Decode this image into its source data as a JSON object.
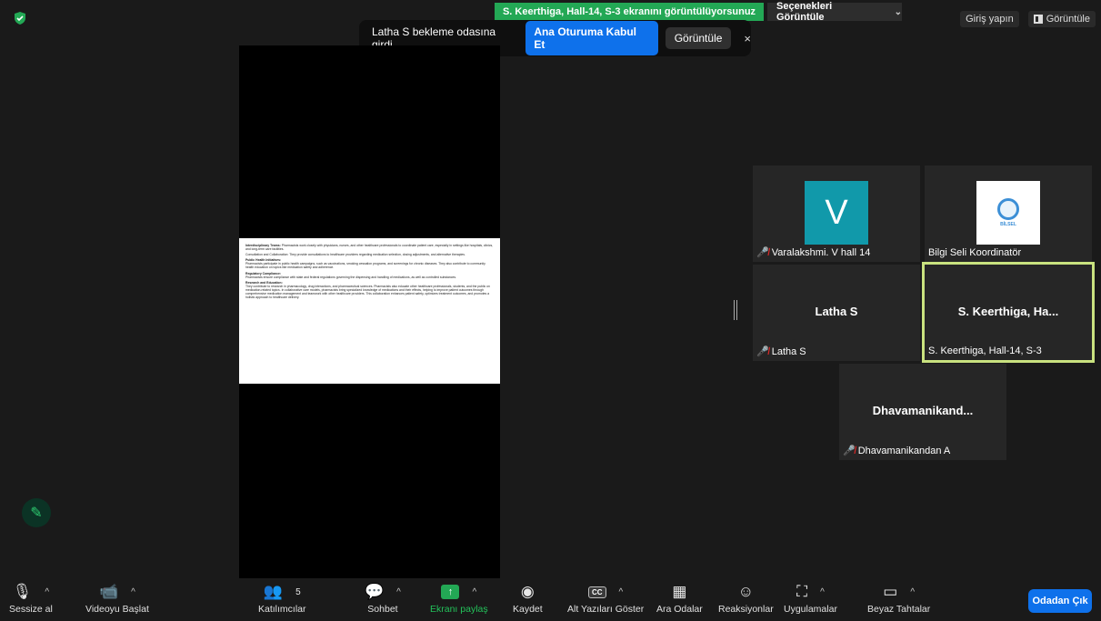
{
  "top": {
    "sharing_banner": "S. Keerthiga, Hall-14, S-3 ekranını görüntülüyorsunuz",
    "view_options": "Seçenekleri Görüntüle",
    "sign_in": "Giriş yapın",
    "view": "Görüntüle"
  },
  "notification": {
    "message": "Latha S bekleme odasına girdi",
    "admit": "Ana Oturuma Kabul Et",
    "view": "Görüntüle",
    "close": "×"
  },
  "document": {
    "paragraphs": [
      {
        "head": "Interdisciplinary Teams:",
        "text": "Pharmacists work closely with physicians, nurses, and other healthcare professionals to coordinate patient care, especially in settings like hospitals, clinics, and long-term care facilities."
      },
      {
        "head": "",
        "text": "Consultation and Collaboration: They provide consultations to healthcare providers regarding medication selection, dosing adjustments, and alternative therapies."
      },
      {
        "head": "Public Health Initiatives:",
        "text": "Pharmacists participate in public health campaigns, such as vaccinations, smoking cessation programs, and screenings for chronic diseases. They also contribute to community health education on topics like medication safety and adherence."
      },
      {
        "head": "Regulatory Compliance:",
        "text": "Pharmacists ensure compliance with state and federal regulations governing the dispensing and handling of medications, as well as controlled substances."
      },
      {
        "head": "Research and Education:",
        "text": "They contribute to research in pharmacology, drug interactions, and pharmaceutical sciences. Pharmacists also educate other healthcare professionals, students, and the public on medication-related topics. In collaborative care models, pharmacists bring specialized knowledge of medications and their effects, helping to improve patient outcomes through comprehensive medication management and teamwork with other healthcare providers. This collaboration enhances patient safety, optimizes treatment outcomes, and promotes a holistic approach to healthcare delivery."
      }
    ]
  },
  "participants": [
    {
      "name": "Varalakshmi. V hall 14",
      "avatar_letter": "V",
      "muted": true
    },
    {
      "name": "Bilgi Seli Koordinatör",
      "logo_text": "BİLSEL",
      "muted": false
    },
    {
      "name": "Latha S",
      "display": "Latha S",
      "muted": true
    },
    {
      "name": "S. Keerthiga, Hall-14, S-3",
      "display": "S. Keerthiga,  Ha...",
      "muted": false
    },
    {
      "name": "Dhavamanikandan A",
      "display": "Dhavamanikand...",
      "muted": true
    }
  ],
  "toolbar": {
    "mute": "Sessize al",
    "video": "Videoyu Başlat",
    "participants": "Katılımcılar",
    "participants_count": "5",
    "chat": "Sohbet",
    "share": "Ekranı paylaş",
    "record": "Kaydet",
    "captions": "Alt Yazıları Göster",
    "captions_icon": "CC",
    "breakout": "Ara Odalar",
    "reactions": "Reaksiyonlar",
    "apps": "Uygulamalar",
    "whiteboard": "Beyaz Tahtalar",
    "leave": "Odadan Çık"
  }
}
